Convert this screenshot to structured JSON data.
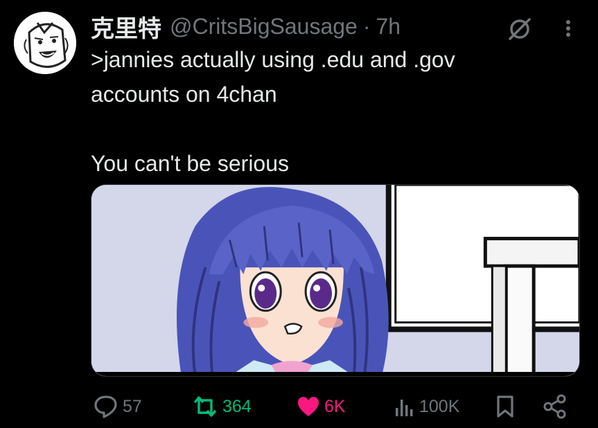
{
  "user": {
    "display_name": "克里特",
    "handle": "@CritsBigSausage",
    "separator": "·",
    "time": "7h",
    "avatar_icon": "cartoon-face-avatar"
  },
  "tweet": {
    "lines": [
      ">jannies actually using .edu and .gov",
      "accounts on 4chan",
      "",
      "You can't be serious"
    ],
    "media_description_icon": "anime-girl-image"
  },
  "actions": {
    "replies": "57",
    "retweets": "364",
    "likes": "6K",
    "views": "100K"
  },
  "colors": {
    "background": "#000000",
    "text": "#e7e9ea",
    "muted": "#71767b",
    "retweet_active": "#00ba7c",
    "like_active": "#f91880"
  },
  "icons": [
    "grok-icon",
    "more-icon",
    "reply-icon",
    "retweet-icon",
    "heart-icon",
    "views-icon",
    "bookmark-icon",
    "share-icon"
  ]
}
